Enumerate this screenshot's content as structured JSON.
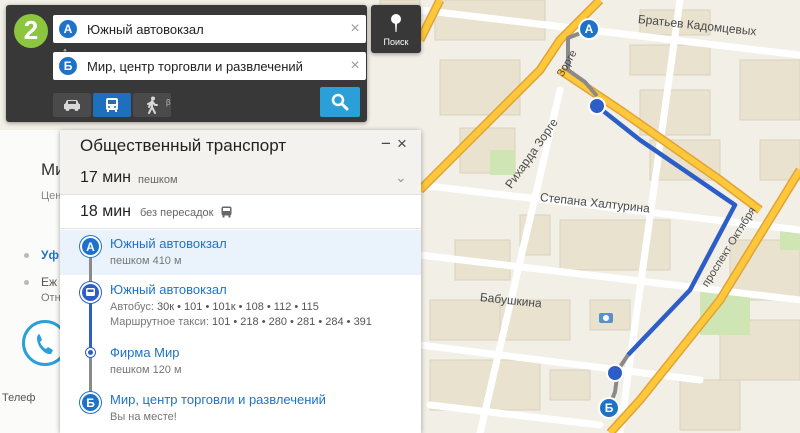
{
  "map": {
    "streets": {
      "kadomtsevykh": "Братьев Кадомцевых",
      "zorge": "Рихарда Зорге",
      "khaltyrina": "Степана Халтурина",
      "babushkina": "Бабушкина",
      "oktyabrya": "проспект Октября",
      "zorge_short": "Зорге"
    },
    "markers": {
      "a": "А",
      "b": "Б"
    }
  },
  "route_panel": {
    "logo": "2",
    "from": {
      "marker": "А",
      "value": "Южный автовокзал"
    },
    "to": {
      "marker": "Б",
      "value": "Мир, центр торговли и развлечений"
    },
    "clear_icon": "×",
    "swap_icon": "↕",
    "modes": [
      "car-icon",
      "bus-icon",
      "walk-icon"
    ],
    "walk_beta": "β"
  },
  "search_button": {
    "label": "Поиск"
  },
  "left_card": {
    "title": "Ми",
    "subtitle": "Цен",
    "link": "Уф",
    "line1": "Еж",
    "line2": "Отн",
    "bottom": "Телеф"
  },
  "transit": {
    "title": "Общественный транспорт",
    "minimize": "−",
    "close": "×",
    "walk": {
      "time": "17 мин",
      "mode": "пешком",
      "arrow": "⌄"
    },
    "summary": {
      "time": "18 мин",
      "note": "без пересадок"
    },
    "steps": [
      {
        "marker": "А",
        "title": "Южный автовокзал",
        "sub1": "пешком 410 м"
      },
      {
        "title": "Южный автовокзал",
        "bus_label": "Автобус:",
        "bus_routes": "30к • 101 • 101к • 108 • 112 • 115",
        "taxi_label": "Маршрутное такси:",
        "taxi_routes": "101 • 218 • 280 • 281 • 284 • 391"
      },
      {
        "title": "Фирма Мир",
        "sub1": "пешком 120 м"
      },
      {
        "marker": "Б",
        "title": "Мир, центр торговли и развлечений",
        "sub1": "Вы на месте!"
      }
    ]
  },
  "colors": {
    "accent_blue": "#1e73c9",
    "route_blue": "#2d5ec7",
    "road_orange": "#f5a623",
    "panel_dark": "#383838",
    "logo_green": "#8cc63f"
  }
}
